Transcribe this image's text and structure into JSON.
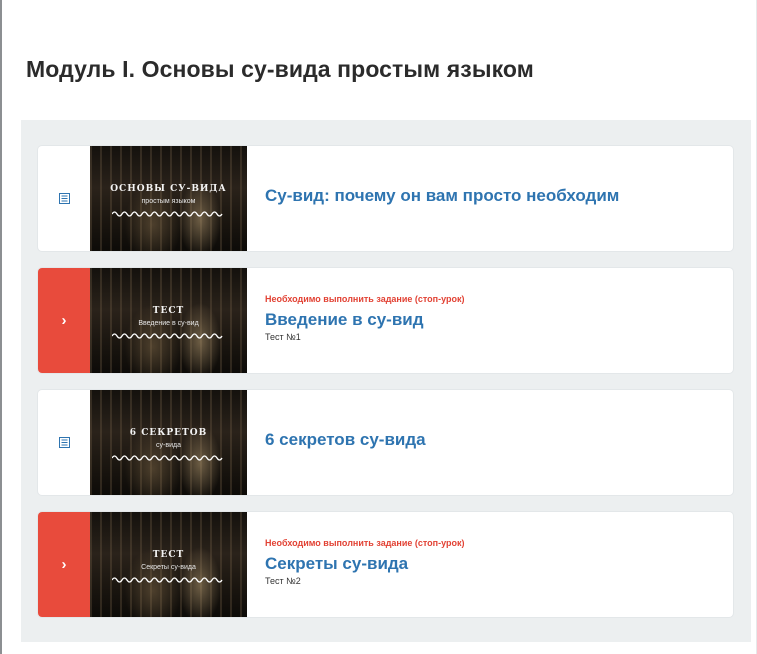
{
  "module": {
    "title": "Модуль I. Основы су-вида простым языком"
  },
  "colors": {
    "locked_accent": "#e84b3c",
    "link": "#2e74b0",
    "panel_bg": "#eceff0"
  },
  "lessons": [
    {
      "type": "lesson",
      "icon": "document-icon",
      "title": "Су-вид: почему он вам просто необходим",
      "thumb_title": "Основы су-вида",
      "thumb_subtitle": "простым языком"
    },
    {
      "type": "test",
      "icon": "chevron-right-icon",
      "status": "Необходимо выполнить задание (стоп-урок)",
      "title": "Введение в су-вид",
      "subtitle": "Тест №1",
      "thumb_title": "Тест",
      "thumb_subtitle": "Введение в су-вид"
    },
    {
      "type": "lesson",
      "icon": "document-icon",
      "title": "6 секретов су-вида",
      "thumb_title": "6 секретов",
      "thumb_subtitle": "су-вида"
    },
    {
      "type": "test",
      "icon": "chevron-right-icon",
      "status": "Необходимо выполнить задание (стоп-урок)",
      "title": "Секреты су-вида",
      "subtitle": "Тест №2",
      "thumb_title": "Тест",
      "thumb_subtitle": "Секреты су-вида"
    }
  ]
}
